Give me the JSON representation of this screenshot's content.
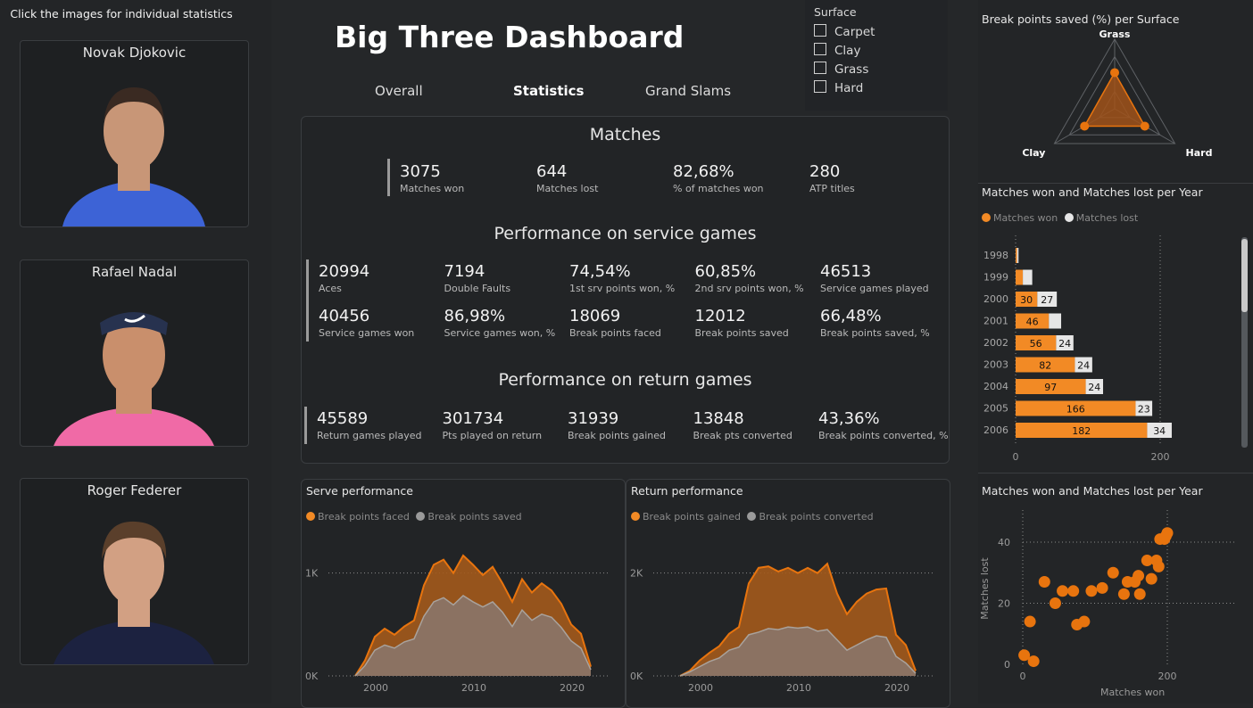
{
  "hint": "Click the images for individual statistics",
  "players": [
    {
      "name": "Novak Djokovic",
      "shirt": "#3d63d6",
      "skin": "#c89677",
      "hair": "#3a2a22"
    },
    {
      "name": "Rafael Nadal",
      "shirt": "#f06aa6",
      "skin": "#c98f6c",
      "hair": "#4a3426"
    },
    {
      "name": "Roger Federer",
      "shirt": "#1c2240",
      "skin": "#d2a083",
      "hair": "#5a3f2b"
    }
  ],
  "title": "Big Three Dashboard",
  "nav": {
    "overall": "Overall",
    "statistics": "Statistics",
    "grand_slams": "Grand Slams"
  },
  "slicer": {
    "title": "Surface",
    "options": [
      "Carpet",
      "Clay",
      "Grass",
      "Hard"
    ]
  },
  "matches": {
    "title": "Matches",
    "kpis": [
      {
        "value": "3075",
        "label": "Matches won"
      },
      {
        "value": "644",
        "label": "Matches lost"
      },
      {
        "value": "82,68%",
        "label": "% of matches won"
      },
      {
        "value": "280",
        "label": "ATP titles"
      }
    ]
  },
  "service": {
    "title": "Performance on service games",
    "kpis": [
      {
        "value": "20994",
        "label": "Aces"
      },
      {
        "value": "7194",
        "label": "Double Faults"
      },
      {
        "value": "74,54%",
        "label": "1st srv points won, %"
      },
      {
        "value": "60,85%",
        "label": "2nd srv points won, %"
      },
      {
        "value": "46513",
        "label": "Service games played"
      },
      {
        "value": "40456",
        "label": "Service games won"
      },
      {
        "value": "86,98%",
        "label": "Service games won, %"
      },
      {
        "value": "18069",
        "label": "Break points faced"
      },
      {
        "value": "12012",
        "label": "Break points saved"
      },
      {
        "value": "66,48%",
        "label": "Break points saved, %"
      }
    ]
  },
  "return_perf": {
    "title": "Performance on return games",
    "kpis": [
      {
        "value": "45589",
        "label": "Return games played"
      },
      {
        "value": "301734",
        "label": "Pts played on return"
      },
      {
        "value": "31939",
        "label": "Break points gained"
      },
      {
        "value": "13848",
        "label": "Break pts converted"
      },
      {
        "value": "43,36%",
        "label": "Break points converted, %"
      }
    ]
  },
  "colors": {
    "orange": "#f28a25",
    "orange_dark": "#e8740e",
    "grey": "#9a9a9a",
    "light": "#e6e6e6"
  },
  "serve_chart": {
    "title": "Serve performance",
    "legend": [
      "Break points faced",
      "Break points saved"
    ],
    "y_ticks": [
      "0K",
      "1K"
    ],
    "x_ticks": [
      "2000",
      "2010",
      "2020"
    ],
    "years": [
      1998,
      1999,
      2000,
      2001,
      2002,
      2003,
      2004,
      2005,
      2006,
      2007,
      2008,
      2009,
      2010,
      2011,
      2012,
      2013,
      2014,
      2015,
      2016,
      2017,
      2018,
      2019,
      2020,
      2021,
      2022
    ],
    "faced": [
      0,
      150,
      380,
      460,
      400,
      480,
      540,
      880,
      1080,
      1130,
      1000,
      1170,
      1080,
      980,
      1060,
      900,
      720,
      940,
      810,
      900,
      830,
      700,
      500,
      410,
      90
    ],
    "saved": [
      0,
      100,
      250,
      300,
      270,
      330,
      360,
      580,
      720,
      760,
      690,
      780,
      720,
      670,
      720,
      620,
      480,
      640,
      540,
      600,
      570,
      470,
      340,
      270,
      60
    ],
    "ylim": [
      0,
      1300
    ]
  },
  "return_chart": {
    "title": "Return performance",
    "legend": [
      "Break points gained",
      "Break points converted"
    ],
    "y_ticks": [
      "0K",
      "2K"
    ],
    "x_ticks": [
      "2000",
      "2010",
      "2020"
    ],
    "years": [
      1998,
      1999,
      2000,
      2001,
      2002,
      2003,
      2004,
      2005,
      2006,
      2007,
      2008,
      2009,
      2010,
      2011,
      2012,
      2013,
      2014,
      2015,
      2016,
      2017,
      2018,
      2019,
      2020,
      2021,
      2022
    ],
    "gained": [
      0,
      100,
      300,
      450,
      580,
      820,
      950,
      1800,
      2100,
      2130,
      2030,
      2100,
      2000,
      2100,
      2000,
      2180,
      1600,
      1200,
      1440,
      1600,
      1680,
      1700,
      800,
      600,
      100
    ],
    "converted": [
      0,
      80,
      180,
      280,
      350,
      500,
      560,
      800,
      850,
      920,
      900,
      950,
      930,
      950,
      870,
      900,
      700,
      500,
      600,
      700,
      780,
      750,
      380,
      250,
      50
    ],
    "ylim": [
      0,
      2600
    ]
  },
  "radar": {
    "title": "Break points saved (%) per Surface",
    "labels": [
      "Grass",
      "Hard",
      "Clay"
    ],
    "values": [
      0.52,
      0.5,
      0.5
    ]
  },
  "bar_chart": {
    "title": "Matches won and Matches lost per Year",
    "legend": [
      "Matches won",
      "Matches lost"
    ],
    "years": [
      "1998",
      "1999",
      "2000",
      "2001",
      "2002",
      "2003",
      "2004",
      "2005",
      "2006"
    ],
    "won": [
      2,
      10,
      30,
      46,
      56,
      82,
      97,
      166,
      182
    ],
    "lost": [
      2,
      13,
      27,
      17,
      24,
      24,
      24,
      23,
      34
    ],
    "won_labels": [
      "",
      "",
      "30",
      "46",
      "56",
      "82",
      "97",
      "166",
      "182"
    ],
    "lost_labels": [
      "",
      "",
      "27",
      "",
      "24",
      "24",
      "24",
      "23",
      "34"
    ],
    "x_ticks": [
      "0",
      "200"
    ],
    "xlim": [
      0,
      200
    ]
  },
  "scatter": {
    "title": "Matches won and Matches lost per Year",
    "xlabel": "Matches won",
    "ylabel": "Matches lost",
    "x_ticks": [
      "0",
      "200"
    ],
    "y_ticks": [
      "0",
      "20",
      "40"
    ],
    "xlim": [
      0,
      200
    ],
    "ylim": [
      0,
      40
    ],
    "points": [
      [
        2,
        3
      ],
      [
        15,
        1
      ],
      [
        10,
        14
      ],
      [
        30,
        27
      ],
      [
        45,
        20
      ],
      [
        55,
        24
      ],
      [
        75,
        13
      ],
      [
        70,
        24
      ],
      [
        85,
        14
      ],
      [
        95,
        24
      ],
      [
        110,
        25
      ],
      [
        125,
        30
      ],
      [
        140,
        23
      ],
      [
        145,
        27
      ],
      [
        155,
        27
      ],
      [
        160,
        29
      ],
      [
        162,
        23
      ],
      [
        172,
        34
      ],
      [
        178,
        28
      ],
      [
        185,
        34
      ],
      [
        188,
        32
      ],
      [
        190,
        41
      ],
      [
        196,
        41
      ],
      [
        200,
        43
      ],
      [
        198,
        42
      ]
    ]
  }
}
